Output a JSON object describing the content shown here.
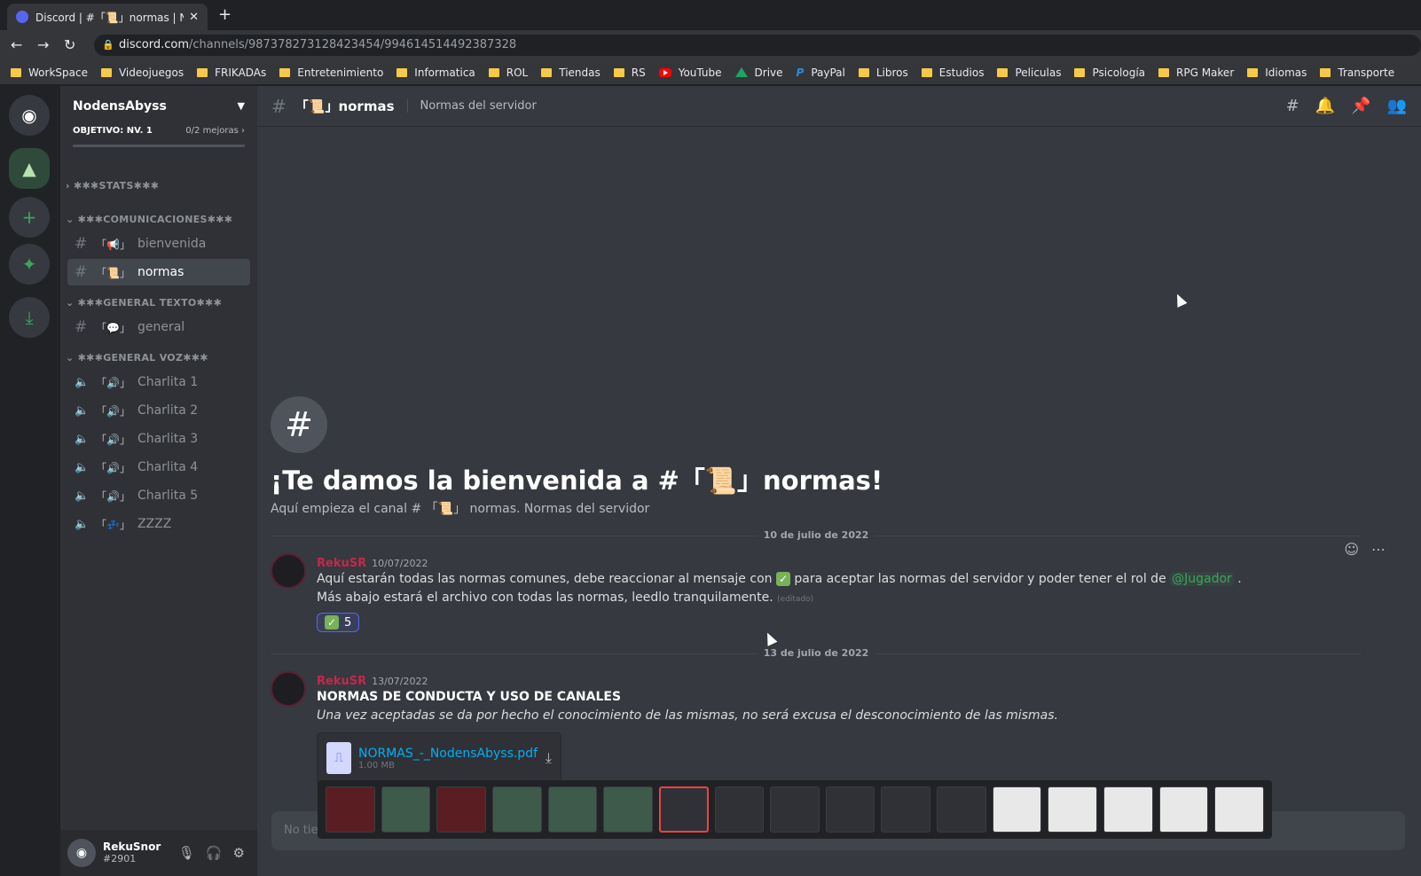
{
  "browser": {
    "tab_title": "Discord | #「📜」normas | Noden",
    "url_domain": "discord.com",
    "url_path": "/channels/987378273128423454/994614514492387328",
    "bookmarks": [
      "WorkSpace",
      "Videojuegos",
      "FRIKADAs",
      "Entretenimiento",
      "Informatica",
      "ROL",
      "Tiendas",
      "RS",
      "YouTube",
      "Drive",
      "PayPal",
      "Libros",
      "Estudios",
      "Peliculas",
      "Psicología",
      "RPG Maker",
      "Idiomas",
      "Transporte"
    ]
  },
  "server": {
    "name": "NodensAbyss",
    "boost_goal": "OBJETIVO: NV. 1",
    "boost_count": "0/2 mejoras",
    "boost_progress": 0
  },
  "categories": [
    {
      "name": "✱✱✱STATS✱✱✱",
      "channels": []
    },
    {
      "name": "✱✱✱COMUNICACIONES✱✱✱",
      "channels": [
        {
          "emoji": "「📢」",
          "name": "bienvenida",
          "type": "text",
          "active": false
        },
        {
          "emoji": "「📜」",
          "name": "normas",
          "type": "text",
          "active": true
        }
      ]
    },
    {
      "name": "✱✱✱GENERAL TEXTO✱✱✱",
      "channels": [
        {
          "emoji": "「💬」",
          "name": "general",
          "type": "text",
          "active": false
        }
      ]
    },
    {
      "name": "✱✱✱GENERAL VOZ✱✱✱",
      "channels": [
        {
          "emoji": "「🔊」",
          "name": "Charlita 1",
          "type": "voice"
        },
        {
          "emoji": "「🔊」",
          "name": "Charlita 2",
          "type": "voice"
        },
        {
          "emoji": "「🔊」",
          "name": "Charlita 3",
          "type": "voice"
        },
        {
          "emoji": "「🔊」",
          "name": "Charlita 4",
          "type": "voice"
        },
        {
          "emoji": "「🔊」",
          "name": "Charlita 5",
          "type": "voice"
        },
        {
          "emoji": "「💤」",
          "name": "ZZZZ",
          "type": "voice"
        }
      ]
    }
  ],
  "user": {
    "name": "RekuSnor",
    "tag": "#2901"
  },
  "channel": {
    "name": "「📜」normas",
    "topic": "Normas del servidor",
    "welcome_title": "¡Te damos la bienvenida a #「📜」normas!",
    "welcome_sub": "Aquí empieza el canal # 「📜」 normas. Normas del servidor"
  },
  "messages": [
    {
      "date_divider": "10 de julio de 2022",
      "author": "RekuSR",
      "timestamp": "10/07/2022",
      "line1_a": "Aquí estarán todas las normas comunes, debe reaccionar al mensaje con",
      "line1_b": "para aceptar las normas del servidor y  poder tener el rol de",
      "mention": "@Jugador",
      "line2": "Más abajo estará el archivo con todas las normas, leedlo tranquilamente.",
      "edited": "(editado)",
      "reaction_count": "5"
    },
    {
      "date_divider": "13 de julio de 2022",
      "author": "RekuSR",
      "timestamp": "13/07/2022",
      "heading": "NORMAS DE CONDUCTA Y USO DE CANALES",
      "italic": "Una vez aceptadas se da por hecho el conocimiento de las mismas, no será excusa el desconocimiento de las mismas.",
      "file_name": "NORMAS_-_NodensAbyss.pdf",
      "file_size": "1.00 MB"
    }
  ],
  "composer_placeholder": "No tie",
  "icons": {
    "discord": "discord-logo",
    "add": "plus-icon",
    "explore": "compass-icon",
    "download": "download-icon"
  },
  "colors": {
    "accent": "#5865f2",
    "author": "#c3294a",
    "mention": "#3ba55d",
    "link": "#00b0f4"
  }
}
